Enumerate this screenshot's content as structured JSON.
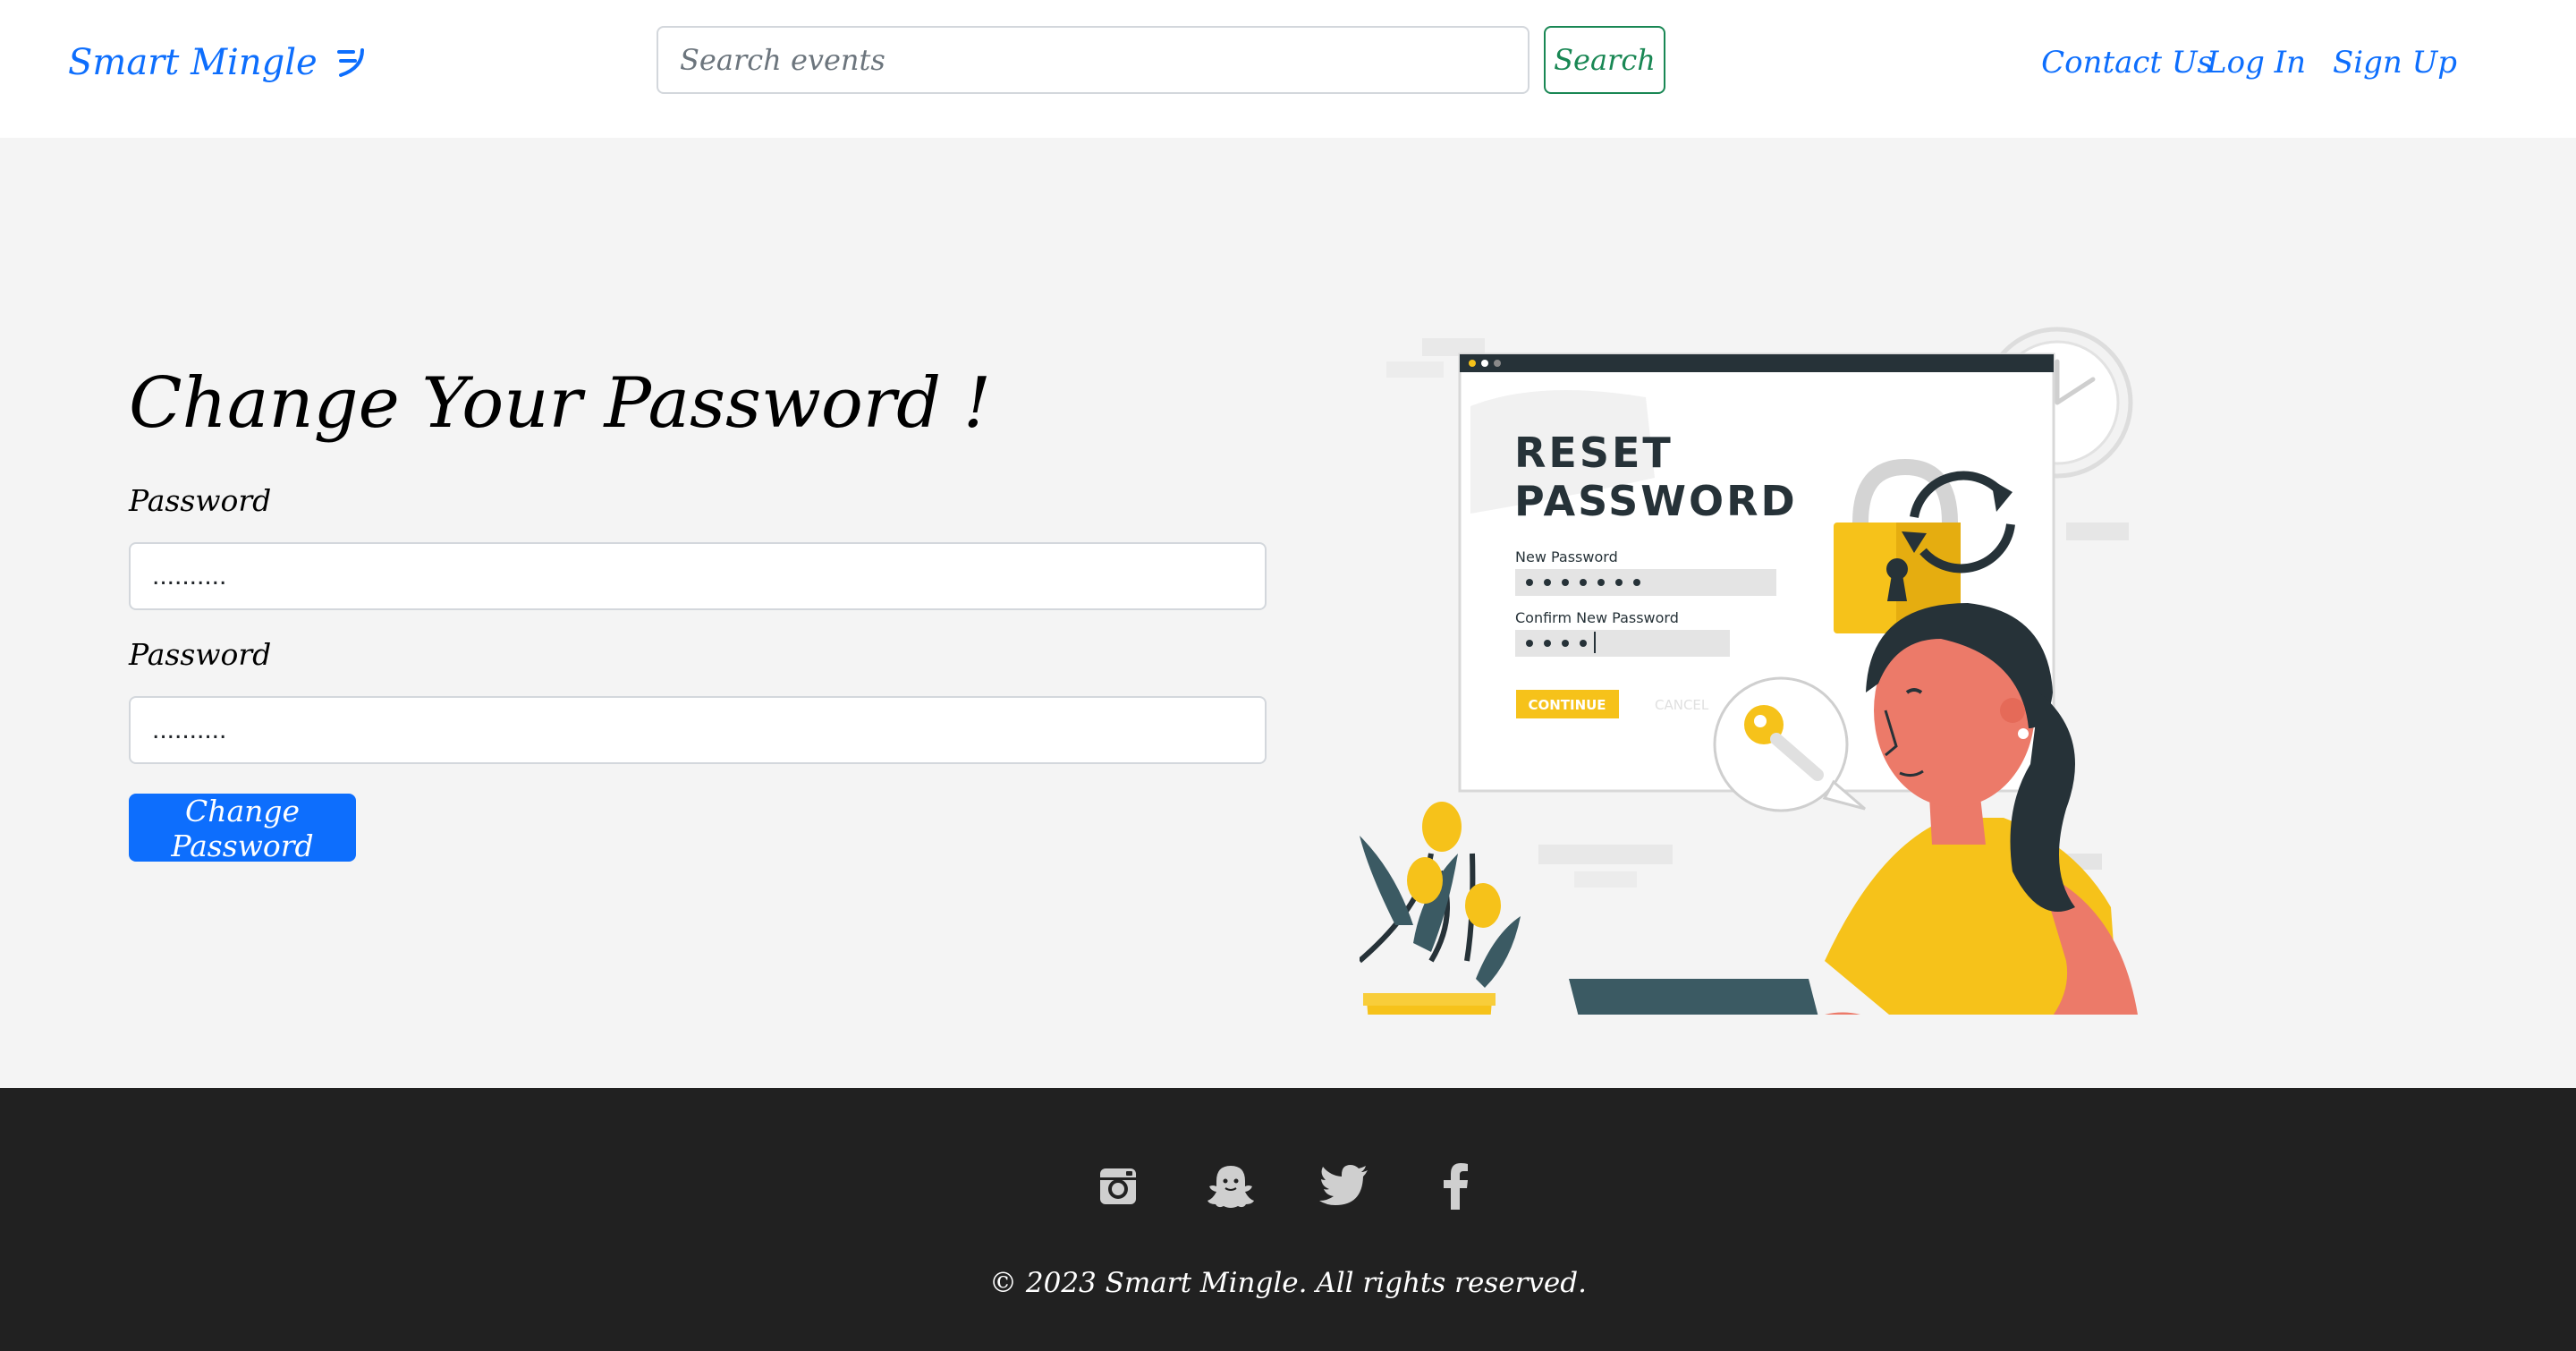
{
  "navbar": {
    "brand": "Smart Mingle",
    "search_placeholder": "Search events",
    "search_value": "",
    "search_button": "Search",
    "links": [
      "Contact Us",
      "Log In",
      "Sign Up"
    ]
  },
  "main": {
    "title": "Change Your Password !",
    "password_label_1": "Password",
    "password_value_1": "..........",
    "password_label_2": "Password",
    "password_value_2": "..........",
    "submit_button": "Change Password"
  },
  "illustration": {
    "heading_line1": "RESET",
    "heading_line2": "PASSWORD",
    "new_password_label": "New Password",
    "confirm_password_label": "Confirm New Password",
    "continue_button": "CONTINUE",
    "cancel_button": "CANCEL"
  },
  "footer": {
    "social_icons": [
      "instagram-icon",
      "snapchat-icon",
      "twitter-icon",
      "facebook-icon"
    ],
    "copyright": "© 2023 Smart Mingle. All rights reserved."
  },
  "colors": {
    "primary": "#0d6efd",
    "success": "#198754",
    "main_bg": "#f4f4f4",
    "footer_bg": "#212121",
    "accent_yellow": "#f6c21a",
    "skin": "#ec7a69",
    "dark_teal": "#3b5a63"
  }
}
